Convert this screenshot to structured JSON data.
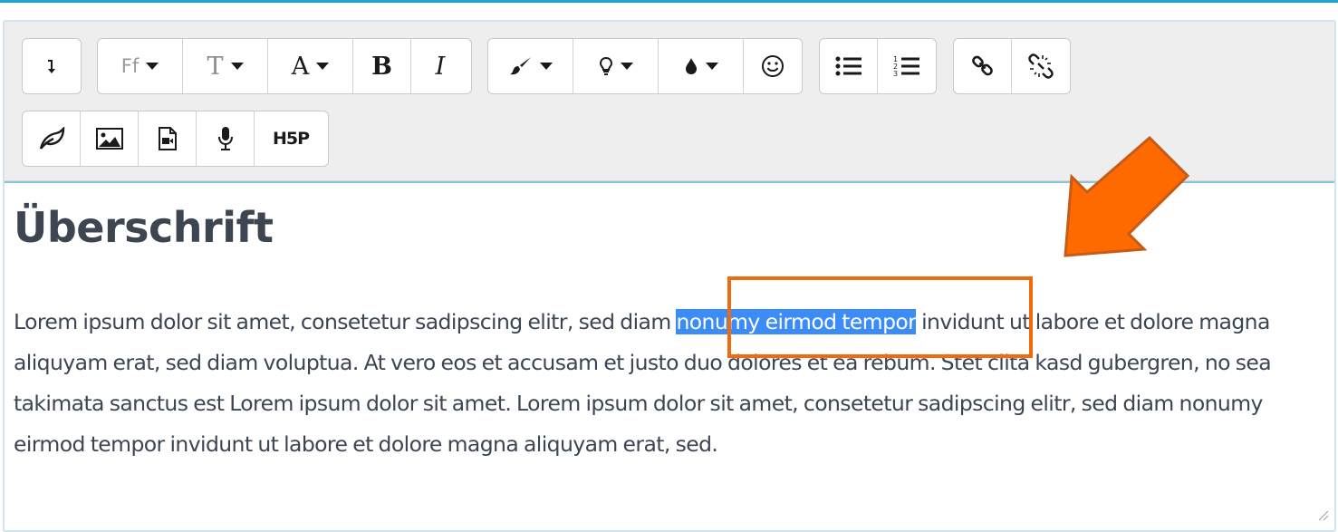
{
  "toolbar": {
    "row1": [
      {
        "name": "paragraph-break-button",
        "icon": "arrow-down-icon"
      },
      {
        "name": "font-family-button",
        "label": "Ff",
        "dropdown": true
      },
      {
        "name": "font-size-button",
        "label": "T",
        "dropdown": true
      },
      {
        "name": "font-color-button",
        "label": "A",
        "dropdown": true
      },
      {
        "name": "bold-button",
        "label": "B"
      },
      {
        "name": "italic-button",
        "label": "I"
      },
      {
        "name": "text-color-button",
        "icon": "brush-icon",
        "dropdown": true
      },
      {
        "name": "lightbulb-button",
        "icon": "lightbulb-icon",
        "dropdown": true
      },
      {
        "name": "background-color-button",
        "icon": "drop-icon",
        "dropdown": true
      },
      {
        "name": "emoticon-button",
        "icon": "smiley-icon"
      },
      {
        "name": "unordered-list-button",
        "icon": "bullet-list-icon"
      },
      {
        "name": "ordered-list-button",
        "icon": "numbered-list-icon",
        "numbers": [
          "1",
          "2",
          "3"
        ]
      },
      {
        "name": "link-button",
        "icon": "link-icon"
      },
      {
        "name": "unlink-button",
        "icon": "unlink-icon"
      }
    ],
    "row2": [
      {
        "name": "leaf-button",
        "icon": "leaf-icon"
      },
      {
        "name": "insert-image-button",
        "icon": "image-icon"
      },
      {
        "name": "insert-media-button",
        "icon": "video-file-icon"
      },
      {
        "name": "record-audio-button",
        "icon": "microphone-icon"
      },
      {
        "name": "insert-h5p-button",
        "label": "H5P"
      }
    ]
  },
  "content": {
    "heading": "Überschrift",
    "paragraph_before": "Lorem ipsum dolor sit amet, consetetur sadipscing elitr, sed diam ",
    "paragraph_selected": "nonumy eirmod tempor",
    "paragraph_after": " invidunt ut labore et dolore magna aliquyam erat, sed diam voluptua. At vero eos et accusam et justo duo dolores et ea rebum. Stet clita kasd gubergren, no sea takimata sanctus est Lorem ipsum dolor sit amet. Lorem ipsum dolor sit amet, consetetur sadipscing elitr, sed diam nonumy eirmod tempor invidunt ut labore et dolore magna aliquyam erat, sed."
  },
  "colors": {
    "accent_line": "#1aa3d6",
    "toolbar_bg": "#eeeeee",
    "selection": "#3b8cf7",
    "annotation_orange": "#f06a0e",
    "arrow_fill": "#ff6a00",
    "text": "#3b4553"
  }
}
